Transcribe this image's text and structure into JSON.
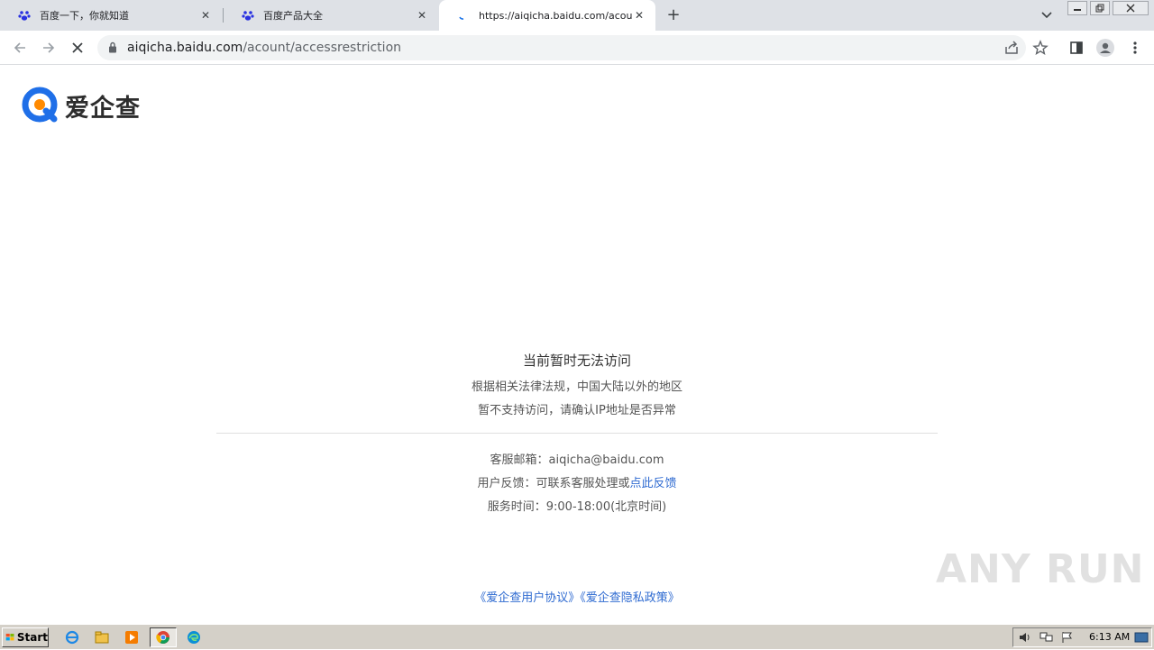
{
  "browser": {
    "tabs": [
      {
        "title": "百度一下，你就知道",
        "active": false
      },
      {
        "title": "百度产品大全",
        "active": false
      },
      {
        "title": "https://aiqicha.baidu.com/acount/ac",
        "active": true
      }
    ],
    "address": {
      "host": "aiqicha.baidu.com",
      "path": "/acount/accessrestriction"
    }
  },
  "page": {
    "logo_text": "爱企查",
    "title": "当前暂时无法访问",
    "notice_line1": "根据相关法律法规，中国大陆以外的地区",
    "notice_line2": "暂不支持访问，请确认IP地址是否异常",
    "email_label": "客服邮箱：",
    "email_value": "aiqicha@baidu.com",
    "feedback_label": "用户反馈：",
    "feedback_text": "可联系客服处理或",
    "feedback_link": "点此反馈",
    "hours_label": "服务时间：",
    "hours_value": "9:00-18:00(北京时间)",
    "footer_user_agreement": "《爱企查用户协议》",
    "footer_privacy_policy": "《爱企查隐私政策》"
  },
  "watermark": "ANY RUN",
  "taskbar": {
    "start_label": "Start",
    "clock": "6:13 AM"
  },
  "colors": {
    "link": "#2f6bd1",
    "logo_blue": "#1f6fe8",
    "logo_orange": "#ff8a00"
  }
}
